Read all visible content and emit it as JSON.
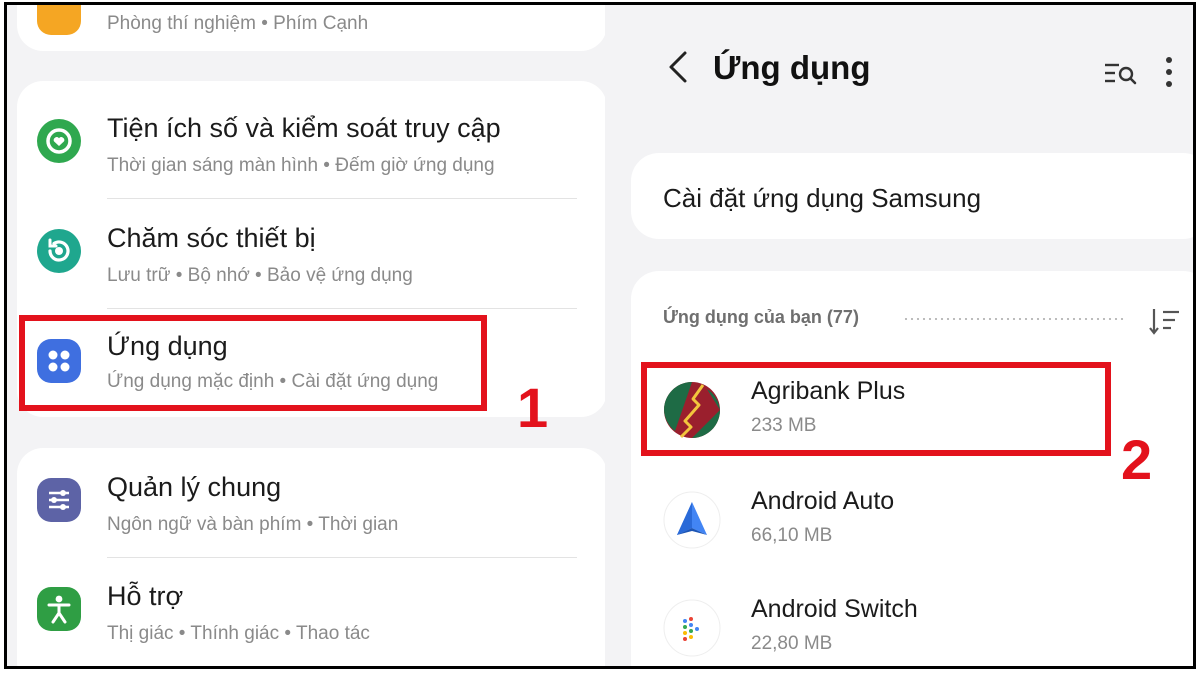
{
  "settings": {
    "items": [
      {
        "title": "",
        "subtitle": "Phòng thí nghiệm • Phím Cạnh"
      },
      {
        "title": "Tiện ích số và kiểm soát truy cập",
        "subtitle": "Thời gian sáng màn hình • Đếm giờ ứng dụng"
      },
      {
        "title": "Chăm sóc thiết bị",
        "subtitle": "Lưu trữ • Bộ nhớ • Bảo vệ ứng dụng"
      },
      {
        "title": "Ứng dụng",
        "subtitle": "Ứng dụng mặc định • Cài đặt ứng dụng"
      },
      {
        "title": "Quản lý chung",
        "subtitle": "Ngôn ngữ và bàn phím • Thời gian"
      },
      {
        "title": "Hỗ trợ",
        "subtitle": "Thị giác • Thính giác • Thao tác"
      }
    ],
    "icons": [
      "labs-icon",
      "digital-wellbeing-icon",
      "device-care-icon",
      "apps-icon",
      "general-management-icon",
      "accessibility-icon"
    ]
  },
  "apps_screen": {
    "title": "Ứng dụng",
    "samsung_settings": "Cài đặt ứng dụng Samsung",
    "section_header": "Ứng dụng của bạn (77)",
    "apps": [
      {
        "name": "Agribank Plus",
        "size": "233 MB"
      },
      {
        "name": "Android Auto",
        "size": "66,10 MB"
      },
      {
        "name": "Android Switch",
        "size": "22,80 MB"
      }
    ]
  },
  "annotations": {
    "step1": "1",
    "step2": "2",
    "highlight_color": "#e3121c"
  },
  "colors": {
    "wellbeing": "#2fa84f",
    "device_care": "#1fa78e",
    "apps": "#3f6fe0",
    "general": "#5d63a6",
    "accessibility": "#2f9e44"
  }
}
